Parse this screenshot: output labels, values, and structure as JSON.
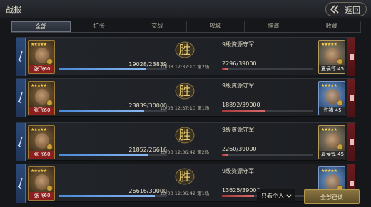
{
  "header": {
    "title": "战报",
    "back_label": "返回"
  },
  "tabs": [
    "全部",
    "扩张",
    "交战",
    "攻城",
    "推演",
    "收藏"
  ],
  "win_char": "胜",
  "rows": [
    {
      "attacker": {
        "name": "张飞",
        "level": "60",
        "score": "19028",
        "max": "23839",
        "ratio": 0.8
      },
      "time": "10/03 12:37:10",
      "round": "第2场",
      "defender": {
        "title": "9级资源守军",
        "name": "夏侯惇",
        "level": "45",
        "score": "2296",
        "max": "39000",
        "ratio": 0.06,
        "style": "green"
      }
    },
    {
      "attacker": {
        "name": "张飞",
        "level": "60",
        "score": "23839",
        "max": "30000",
        "ratio": 0.79
      },
      "time": "10/03 12:37:10",
      "round": "第1场",
      "defender": {
        "title": "9级资源守军",
        "name": "许褚",
        "level": "45",
        "score": "18892",
        "max": "39000",
        "ratio": 0.48,
        "style": "blue"
      }
    },
    {
      "attacker": {
        "name": "张飞",
        "level": "60",
        "score": "21852",
        "max": "26616",
        "ratio": 0.82
      },
      "time": "10/03 12:36:42",
      "round": "第2场",
      "defender": {
        "title": "9级资源守军",
        "name": "夏侯惇",
        "level": "45",
        "score": "2260",
        "max": "39000",
        "ratio": 0.06,
        "style": "green"
      }
    },
    {
      "attacker": {
        "name": "张飞",
        "level": "60",
        "score": "26616",
        "max": "30000",
        "ratio": 0.89
      },
      "time": "10/03 12:36:42",
      "round": "第1场",
      "defender": {
        "title": "9级资源守军",
        "name": "许褚",
        "level": "45",
        "score": "13625",
        "max": "39000",
        "ratio": 0.35,
        "style": "blue"
      }
    }
  ],
  "footer": {
    "filter_label": "只看个人",
    "read_all_label": "全部已读"
  }
}
